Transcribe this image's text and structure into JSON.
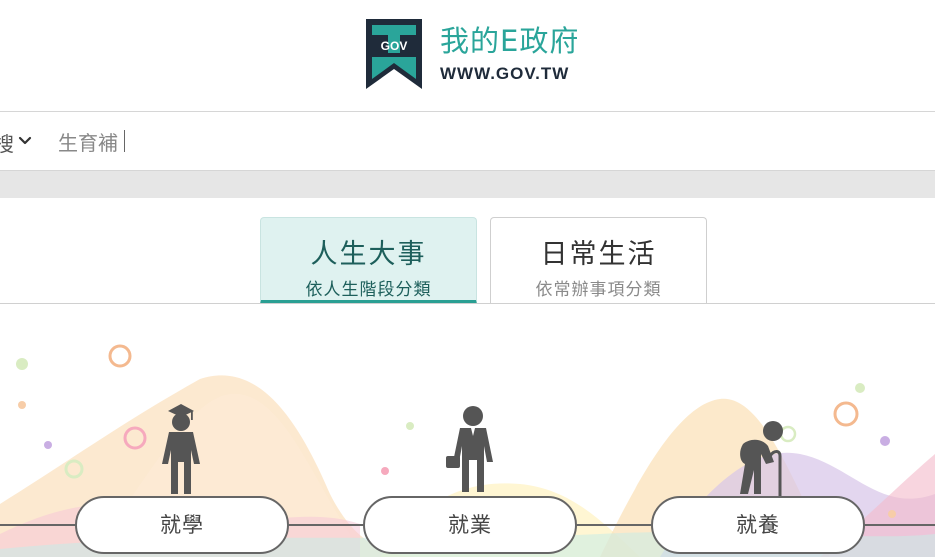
{
  "header": {
    "logo_title": "我的E政府",
    "logo_url": "WWW.GOV.TW",
    "logo_badge": "GOV"
  },
  "search": {
    "scope_label": "搜",
    "value": "生育補"
  },
  "tabs": [
    {
      "label": "人生大事",
      "sub": "依人生階段分類",
      "active": true
    },
    {
      "label": "日常生活",
      "sub": "依常辦事項分類",
      "active": false
    }
  ],
  "stages": [
    {
      "label": "就學",
      "icon": "graduate-icon"
    },
    {
      "label": "就業",
      "icon": "businessman-icon"
    },
    {
      "label": "就養",
      "icon": "elderly-icon"
    }
  ],
  "colors": {
    "brand_teal": "#2aa59a",
    "logo_navy": "#1f2b3a",
    "active_tab_bg": "#dff2f0",
    "active_tab_border": "#2a9f93"
  }
}
